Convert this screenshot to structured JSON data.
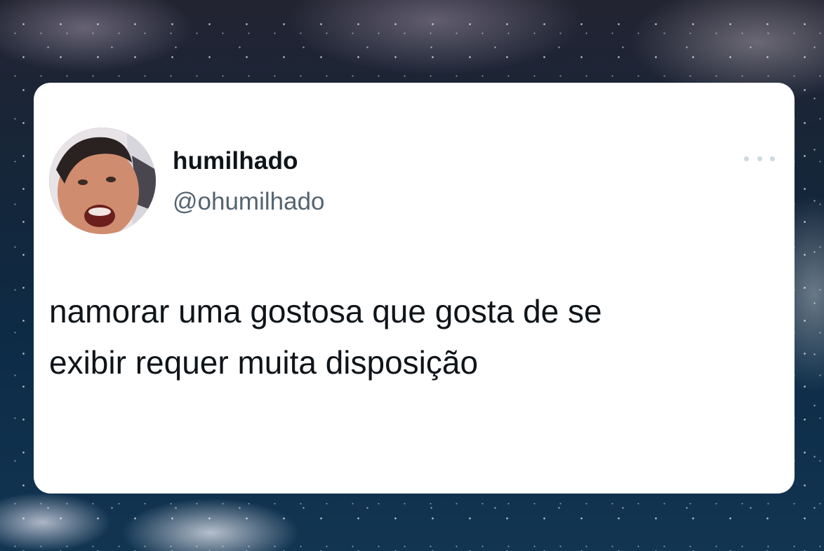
{
  "tweet": {
    "display_name": "humilhado",
    "handle": "@ohumilhado",
    "text_line1": "namorar uma gostosa que gosta de se",
    "text_line2": "exibir requer muita disposição",
    "avatar_icon": "profile-photo",
    "menu_icon": "more-horizontal-icon"
  },
  "colors": {
    "card_background": "#ffffff",
    "name_color": "#0f1419",
    "handle_color": "#536471",
    "menu_dots_color": "#cfd9de"
  }
}
